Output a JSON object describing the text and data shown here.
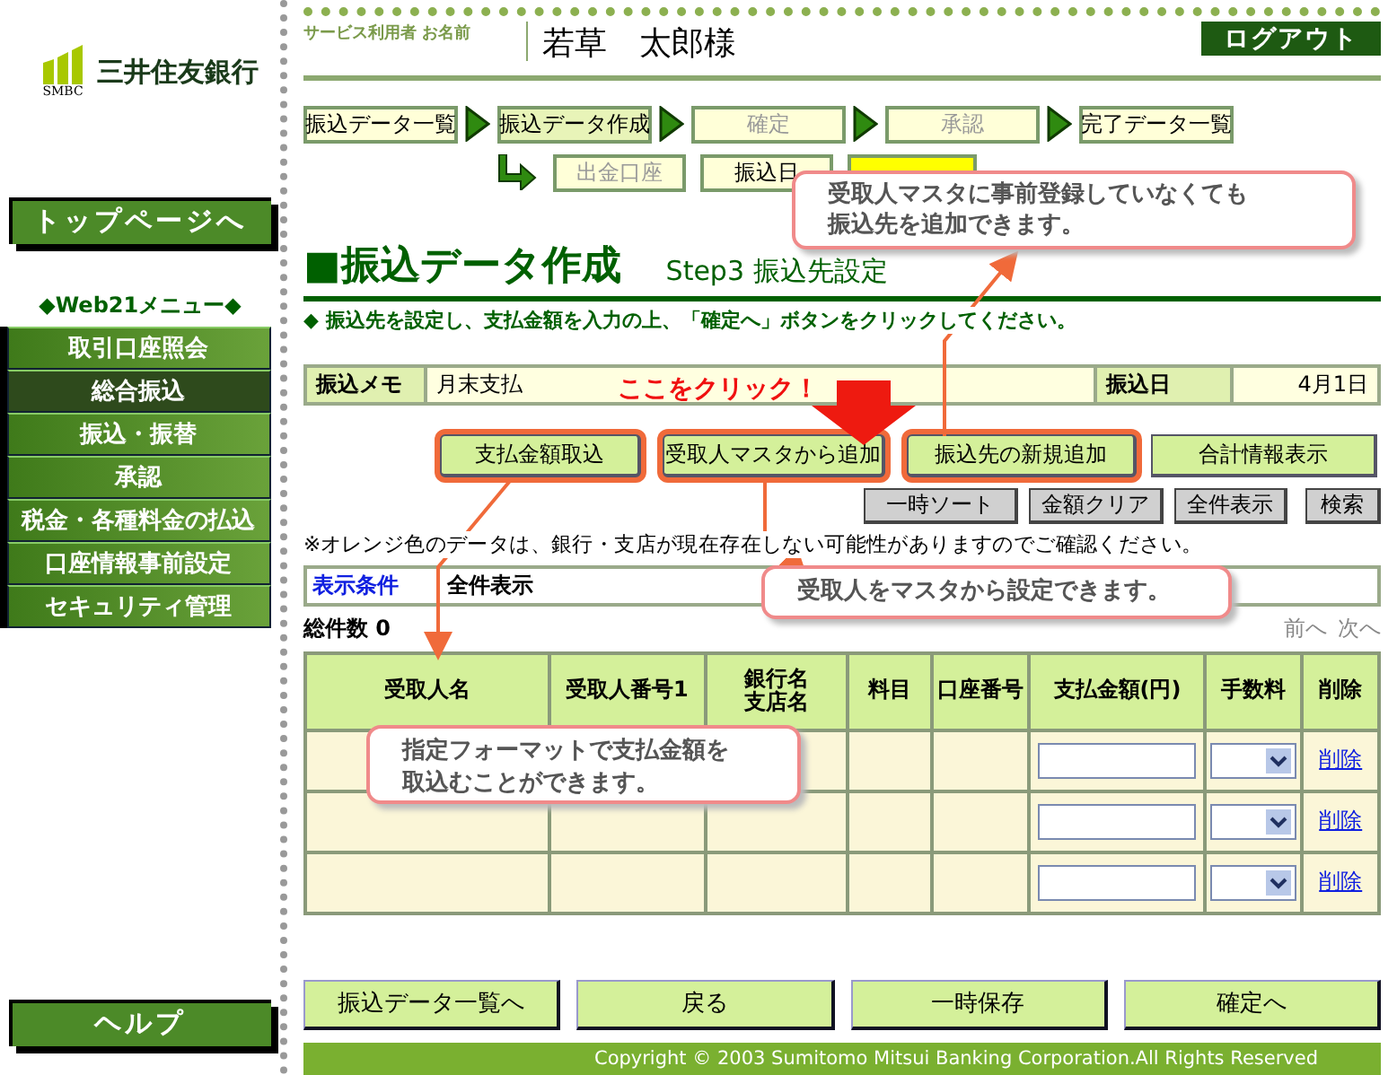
{
  "sidebar": {
    "logo": {
      "name": "三井住友銀行",
      "abbr": "SMBC"
    },
    "top_button": "トップページへ",
    "menu_title": "◆Web21メニュー◆",
    "menu": [
      {
        "label": "取引口座照会",
        "selected": false
      },
      {
        "label": "総合振込",
        "selected": true
      },
      {
        "label": "振込・振替",
        "selected": false
      },
      {
        "label": "承認",
        "selected": false
      },
      {
        "label": "税金・各種料金の払込",
        "selected": false
      },
      {
        "label": "口座情報事前設定",
        "selected": false
      },
      {
        "label": "セキュリティ管理",
        "selected": false
      }
    ],
    "help_button": "ヘルプ"
  },
  "header": {
    "user_label": "サービス利用者 お名前",
    "user_name": "若草　太郎様",
    "logout": "ログアウト"
  },
  "steps": [
    {
      "label": "振込データ一覧",
      "selected": false,
      "disabled": false
    },
    {
      "label": "振込データ作成",
      "selected": true,
      "disabled": false
    },
    {
      "label": "確定",
      "selected": false,
      "disabled": true
    },
    {
      "label": "承認",
      "selected": false,
      "disabled": true
    },
    {
      "label": "完了データ一覧",
      "selected": false,
      "disabled": false
    }
  ],
  "substeps": [
    {
      "label": "出金口座",
      "selected": false,
      "disabled": true
    },
    {
      "label": "振込日",
      "selected": false,
      "disabled": false
    },
    {
      "selected": true,
      "disabled": false
    }
  ],
  "title": "■振込データ作成",
  "step": "Step3 振込先設定",
  "instruction": "◆ 振込先を設定し、支払金額を入力の上、「確定へ」ボタンをクリックしてください。",
  "memo": {
    "label": "振込メモ",
    "value": "月末支払",
    "date_label": "振込日",
    "date": "4月1日"
  },
  "actions": [
    {
      "label": "支払金額取込",
      "highlighted": true
    },
    {
      "label": "受取人マスタから追加",
      "highlighted": true
    },
    {
      "label": "振込先の新規追加",
      "highlighted": true
    },
    {
      "label": "合計情報表示",
      "highlighted": false
    }
  ],
  "tools": [
    "一時ソート",
    "金額クリア",
    "全件表示",
    "検索"
  ],
  "note": "※オレンジ色のデータは、銀行・支店が現在存在しない可能性がありますのでご確認ください。",
  "filter": {
    "label": "表示条件",
    "value": "全件表示"
  },
  "total": "総件数 0",
  "pager": [
    "前へ",
    "次へ"
  ],
  "table": {
    "columns": [
      {
        "lines": [
          "受取人名"
        ]
      },
      {
        "lines": [
          "受取人番号1"
        ]
      },
      {
        "lines": [
          "銀行名",
          "支店名"
        ]
      },
      {
        "lines": [
          "料目"
        ]
      },
      {
        "lines": [
          "口座番号"
        ]
      },
      {
        "lines": [
          "支払金額(円)"
        ]
      },
      {
        "lines": [
          "手数料"
        ]
      },
      {
        "lines": [
          "削除"
        ]
      }
    ],
    "rows": [
      {
        "delete": "削除"
      },
      {
        "delete": "削除"
      },
      {
        "delete": "削除"
      }
    ]
  },
  "bottom_buttons": [
    "振込データ一覧へ",
    "戻る",
    "一時保存",
    "確定へ"
  ],
  "copyright": "Copyright © 2003 Sumitomo Mitsui Banking Corporation.All Rights Reserved",
  "annotations": {
    "click_hint": "ここをクリック！",
    "callouts": [
      {
        "lines": [
          "受取人マスタに事前登録していなくても",
          "振込先を追加できます。"
        ]
      },
      {
        "lines": [
          "受取人をマスタから設定できます。"
        ]
      },
      {
        "lines": [
          "指定フォーマットで支払金額を",
          "取込むことができます。"
        ]
      }
    ]
  }
}
